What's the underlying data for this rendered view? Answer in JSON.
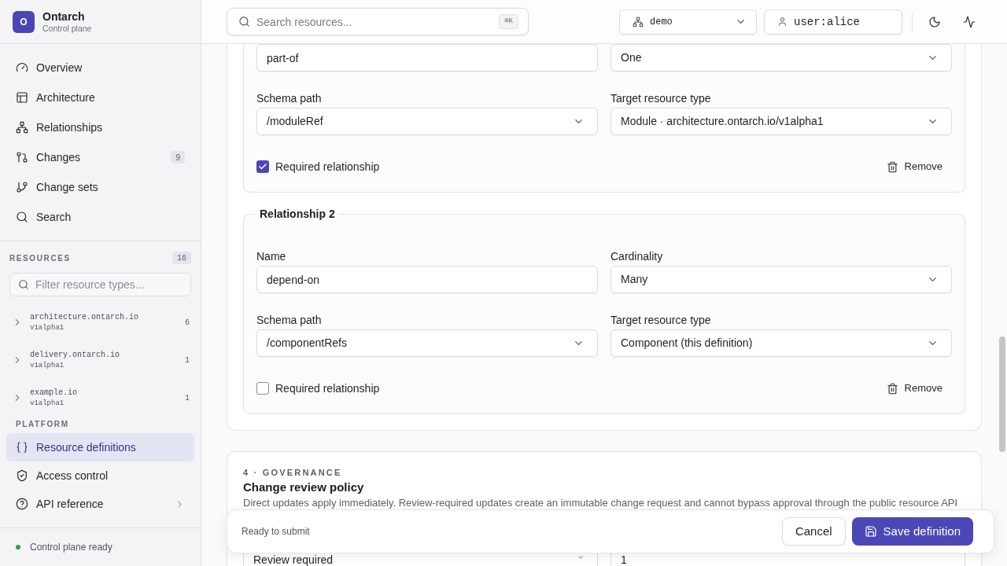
{
  "sidebar": {
    "brand": {
      "logo": "O",
      "name": "Ontarch",
      "subtitle": "Control plane"
    },
    "nav": [
      {
        "label": "Overview",
        "selected": false
      },
      {
        "label": "Architecture",
        "selected": false
      },
      {
        "label": "Relationships",
        "selected": false
      },
      {
        "label": "Changes",
        "badge": "9",
        "selected": false
      },
      {
        "label": "Change sets",
        "selected": false
      },
      {
        "label": "Search",
        "selected": false
      }
    ],
    "resources": {
      "title": "RESOURCES",
      "count": "16",
      "filter_placeholder": "Filter resource types...",
      "groups": [
        {
          "name": "architecture.ontarch.io",
          "version": "v1alpha1",
          "count": "6",
          "expanded": false
        },
        {
          "name": "delivery.ontarch.io",
          "version": "v1alpha1",
          "count": "1",
          "expanded": false
        },
        {
          "name": "example.io",
          "version": "v1alpha1",
          "count": "1",
          "expanded": false
        }
      ]
    },
    "platform": {
      "title": "PLATFORM",
      "items": [
        {
          "label": "Resource definitions",
          "kind": "link",
          "selected": true
        },
        {
          "label": "Access control",
          "kind": "link",
          "selected": false
        },
        {
          "label": "API reference",
          "kind": "submenu",
          "selected": false
        }
      ]
    },
    "status": {
      "label": "Control plane ready",
      "ready": true
    }
  },
  "topbar": {
    "search": {
      "placeholder": "Search resources...",
      "shortcut": "⌘K"
    },
    "namespace": {
      "value": "demo"
    },
    "user": {
      "value": "user:alice"
    }
  },
  "main": {
    "relationships": [
      {
        "fields": [
          {
            "kind": "text",
            "value": "part-of"
          },
          {
            "kind": "select",
            "value": "One"
          },
          {
            "kind": "select",
            "label": "Schema path",
            "value": "/moduleRef"
          },
          {
            "kind": "select",
            "label": "Target resource type",
            "value": "Module · architecture.ontarch.io/v1alpha1"
          }
        ],
        "required": {
          "label": "Required relationship",
          "checked": true
        },
        "remove": "Remove"
      },
      {
        "legend": "Relationship 2",
        "fields": [
          {
            "kind": "text",
            "label": "Name",
            "value": "depend-on"
          },
          {
            "kind": "select",
            "label": "Cardinality",
            "value": "Many"
          },
          {
            "kind": "select",
            "label": "Schema path",
            "value": "/componentRefs"
          },
          {
            "kind": "select",
            "label": "Target resource type",
            "value": "Component (this definition)"
          }
        ],
        "required": {
          "label": "Required relationship",
          "checked": false
        },
        "remove": "Remove"
      }
    ],
    "governance": {
      "step": "4 · GOVERNANCE",
      "title": "Change review policy",
      "description": "Direct updates apply immediately. Review-required updates create an immutable change request and cannot bypass approval through the public resource API",
      "fields": [
        {
          "kind": "select",
          "value": "Review required"
        },
        {
          "kind": "text",
          "value": "1"
        }
      ]
    }
  },
  "footer": {
    "status": "Ready to submit",
    "buttons": [
      {
        "label": "Cancel",
        "kind": "secondary"
      },
      {
        "label": "Save definition",
        "kind": "primary"
      }
    ]
  }
}
